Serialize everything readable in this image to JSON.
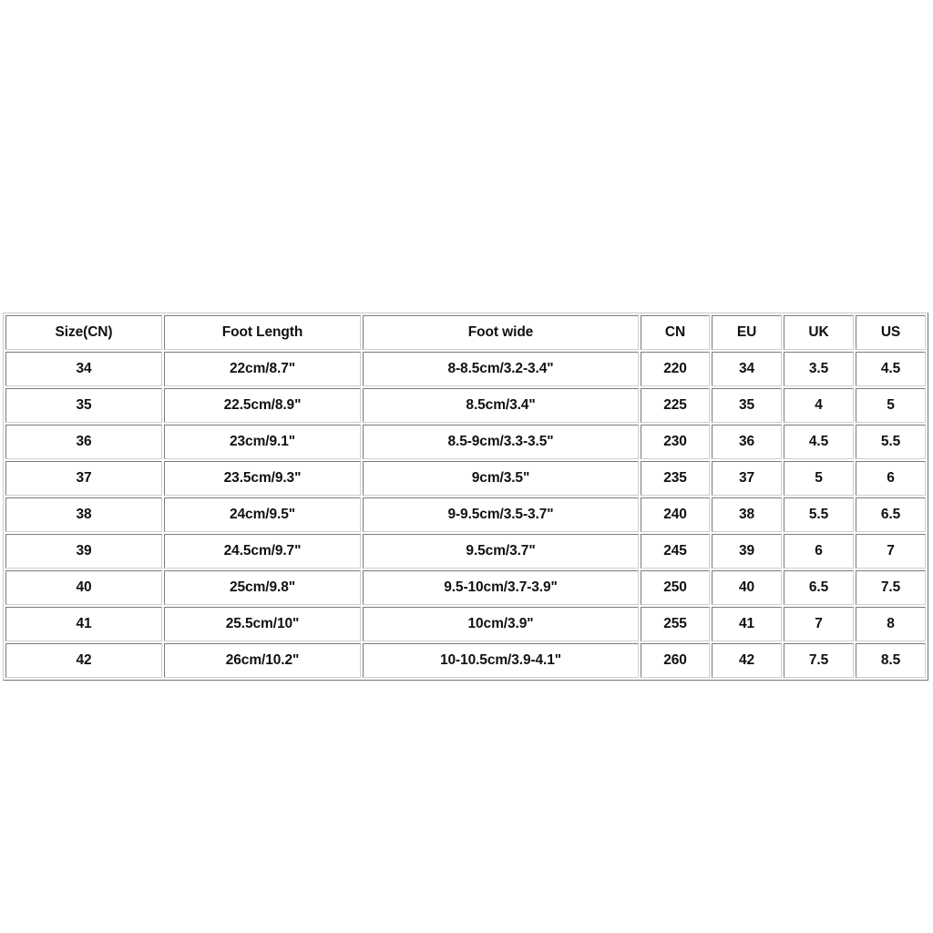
{
  "table": {
    "name": "shoe-size-conversion-chart",
    "columns": [
      {
        "key": "size_cn",
        "label": "Size(CN)"
      },
      {
        "key": "foot_length",
        "label": "Foot Length"
      },
      {
        "key": "foot_wide",
        "label": "Foot wide"
      },
      {
        "key": "cn",
        "label": "CN"
      },
      {
        "key": "eu",
        "label": "EU"
      },
      {
        "key": "uk",
        "label": "UK"
      },
      {
        "key": "us",
        "label": "US"
      }
    ],
    "rows": [
      {
        "size_cn": "34",
        "foot_length": "22cm/8.7\"",
        "foot_wide": "8-8.5cm/3.2-3.4\"",
        "cn": "220",
        "eu": "34",
        "uk": "3.5",
        "us": "4.5"
      },
      {
        "size_cn": "35",
        "foot_length": "22.5cm/8.9\"",
        "foot_wide": "8.5cm/3.4\"",
        "cn": "225",
        "eu": "35",
        "uk": "4",
        "us": "5"
      },
      {
        "size_cn": "36",
        "foot_length": "23cm/9.1\"",
        "foot_wide": "8.5-9cm/3.3-3.5\"",
        "cn": "230",
        "eu": "36",
        "uk": "4.5",
        "us": "5.5"
      },
      {
        "size_cn": "37",
        "foot_length": "23.5cm/9.3\"",
        "foot_wide": "9cm/3.5\"",
        "cn": "235",
        "eu": "37",
        "uk": "5",
        "us": "6"
      },
      {
        "size_cn": "38",
        "foot_length": "24cm/9.5\"",
        "foot_wide": "9-9.5cm/3.5-3.7\"",
        "cn": "240",
        "eu": "38",
        "uk": "5.5",
        "us": "6.5"
      },
      {
        "size_cn": "39",
        "foot_length": "24.5cm/9.7\"",
        "foot_wide": "9.5cm/3.7\"",
        "cn": "245",
        "eu": "39",
        "uk": "6",
        "us": "7"
      },
      {
        "size_cn": "40",
        "foot_length": "25cm/9.8\"",
        "foot_wide": "9.5-10cm/3.7-3.9\"",
        "cn": "250",
        "eu": "40",
        "uk": "6.5",
        "us": "7.5"
      },
      {
        "size_cn": "41",
        "foot_length": "25.5cm/10\"",
        "foot_wide": "10cm/3.9\"",
        "cn": "255",
        "eu": "41",
        "uk": "7",
        "us": "8"
      },
      {
        "size_cn": "42",
        "foot_length": "26cm/10.2\"",
        "foot_wide": "10-10.5cm/3.9-4.1\"",
        "cn": "260",
        "eu": "42",
        "uk": "7.5",
        "us": "8.5"
      }
    ]
  },
  "colors": {
    "page_background": "#ffffff",
    "cell_background": "#ffffff",
    "border": "#cfcfcf",
    "text": "#111111"
  }
}
